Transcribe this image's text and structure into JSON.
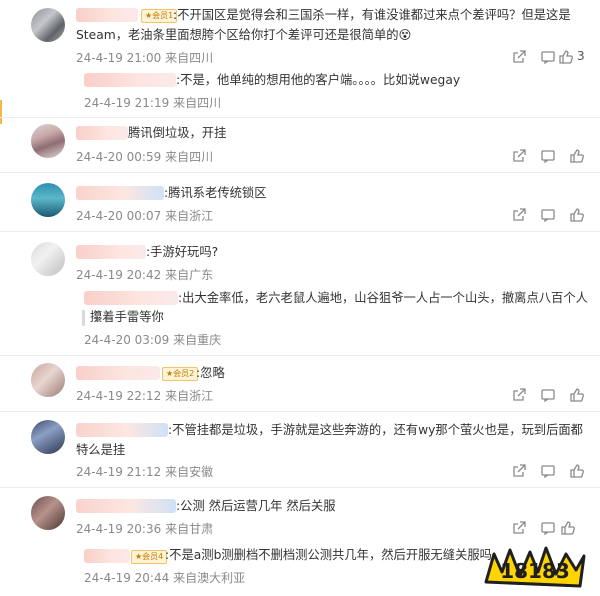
{
  "comments": [
    {
      "text": ":不开国区是觉得会和三国杀一样，有谁没谁都过来点个差评吗？但是这是",
      "text2": "Steam，老油条里面想胯个区给你打个差评可还是很简单的😵",
      "badge": "★会员1",
      "time": "24-4-19 21:00",
      "location": "来自四川",
      "likes": "3"
    },
    {
      "text": ":不是，他单纯的想用他的客户端。。。。比如说wegay",
      "time": "24-4-19 21:19",
      "location": "来自四川"
    },
    {
      "text": "腾讯倒垃圾，开挂",
      "time": "24-4-20 00:59",
      "location": "来自四川"
    },
    {
      "text": ":腾讯系老传统锁区",
      "time": "24-4-20 00:07",
      "location": "来自浙江"
    },
    {
      "text": ":手游好玩吗?",
      "time": "24-4-19 20:42",
      "location": "来自广东"
    },
    {
      "text": ":出大金率低，老六老鼠人遍地，山谷狙爷一人占一个山头，撤离点八百个人",
      "text2": "攥着手雷等你",
      "time": "24-4-20 03:09",
      "location": "来自重庆"
    },
    {
      "text": ":忽略",
      "badge": "★会员2",
      "time": "24-4-19 22:12",
      "location": "来自浙江"
    },
    {
      "text": ":不管挂都是垃圾，手游就是这些奔游的，还有wy那个萤火也是，玩到后面都",
      "text2": "特么是挂",
      "time": "24-4-19 21:12",
      "location": "来自安徽"
    },
    {
      "text": ":公测 然后运营几年 然后关服",
      "time": "24-4-19 20:36",
      "location": "来自甘肃"
    },
    {
      "text": ":不是a测b测删档不删档测公测共几年，然后开服无缝关服吗",
      "badge": "★会员4",
      "time": "24-4-19 20:44",
      "location": "来自澳大利亚"
    }
  ],
  "watermark": "18183",
  "colors": {
    "accent": "#f7b84b",
    "meta": "#8a8a8a",
    "text": "#333333",
    "badge": "#c27a00"
  }
}
